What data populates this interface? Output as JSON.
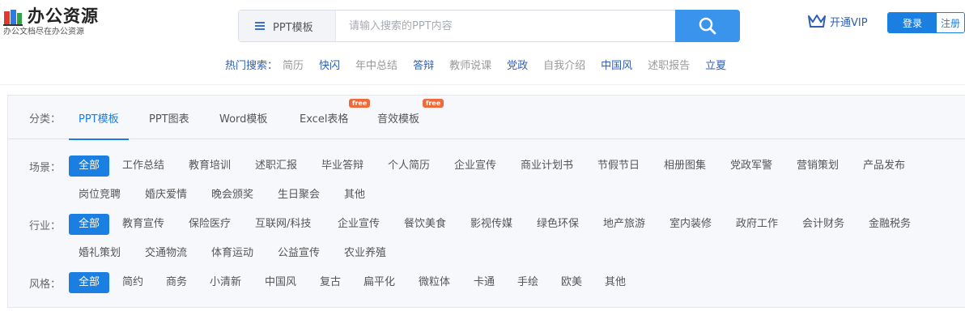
{
  "brand": {
    "title": "办公资源",
    "subtitle": "办公文档尽在办公资源",
    "colors": {
      "primary": "#1a7fe0",
      "search_button": "#3a94ec",
      "free_badge": "#ef6a3a",
      "nav_blue": "#2f5fb3"
    }
  },
  "search": {
    "type_label": "PPT模板",
    "placeholder": "请输入搜索的PPT内容",
    "icon": "search-icon"
  },
  "header": {
    "vip_label": "开通VIP",
    "vip_icon": "crown-icon",
    "login_label": "登录",
    "register_label": "注册"
  },
  "hot_search": {
    "label": "热门搜索：",
    "items": [
      {
        "text": "简历",
        "color": "#999999"
      },
      {
        "text": "快闪",
        "color": "#2f5fb3"
      },
      {
        "text": "年中总结",
        "color": "#999999"
      },
      {
        "text": "答辩",
        "color": "#2f5fb3"
      },
      {
        "text": "教师说课",
        "color": "#999999"
      },
      {
        "text": "党政",
        "color": "#2f5fb3"
      },
      {
        "text": "自我介绍",
        "color": "#999999"
      },
      {
        "text": "中国风",
        "color": "#2f5fb3"
      },
      {
        "text": "述职报告",
        "color": "#999999"
      },
      {
        "text": "立夏",
        "color": "#2f5fb3"
      }
    ]
  },
  "category": {
    "label": "分类：",
    "tabs": [
      {
        "label": "PPT模板",
        "active": true
      },
      {
        "label": "PPT图表"
      },
      {
        "label": "Word模板"
      },
      {
        "label": "Excel表格",
        "badge": "free"
      },
      {
        "label": "音效模板",
        "badge": "free"
      }
    ]
  },
  "filters": {
    "scene": {
      "label": "场景：",
      "items": [
        "全部",
        "工作总结",
        "教育培训",
        "述职汇报",
        "毕业答辩",
        "个人简历",
        "企业宣传",
        "商业计划书",
        "节假节日",
        "相册图集",
        "党政军警",
        "营销策划",
        "产品发布",
        "岗位竞聘",
        "婚庆爱情",
        "晚会颁奖",
        "生日聚会",
        "其他"
      ]
    },
    "industry": {
      "label": "行业：",
      "items": [
        "全部",
        "教育宣传",
        "保险医疗",
        "互联网/科技",
        "企业宣传",
        "餐饮美食",
        "影视传媒",
        "绿色环保",
        "地产旅游",
        "室内装修",
        "政府工作",
        "会计财务",
        "金融税务",
        "婚礼策划",
        "交通物流",
        "体育运动",
        "公益宣传",
        "农业养殖"
      ]
    },
    "style": {
      "label": "风格：",
      "items": [
        "全部",
        "简约",
        "商务",
        "小清新",
        "中国风",
        "复古",
        "扁平化",
        "微粒体",
        "卡通",
        "手绘",
        "欧美",
        "其他"
      ]
    }
  }
}
